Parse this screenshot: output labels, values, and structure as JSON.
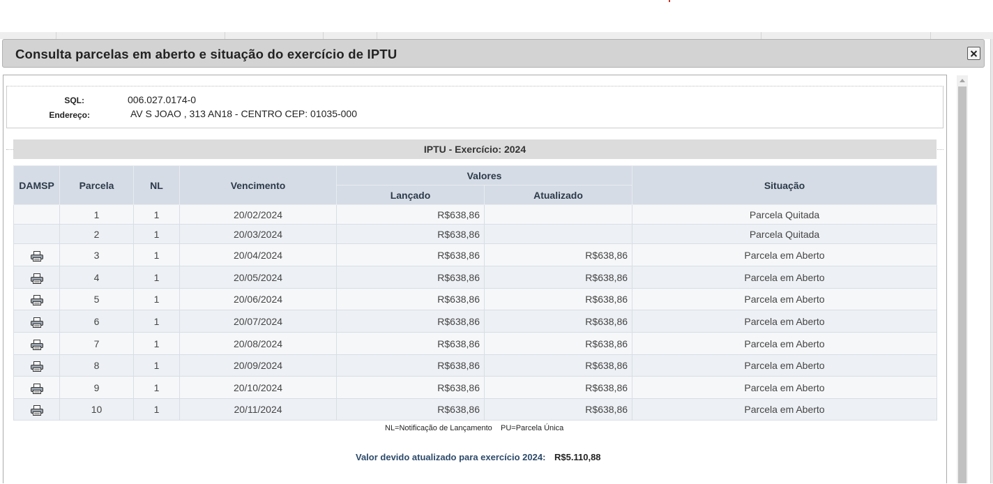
{
  "dialog": {
    "title": "Consulta parcelas em aberto e situação do exercício de IPTU"
  },
  "property": {
    "sql_label": "SQL:",
    "sql_value": "006.027.0174-0",
    "address_label": "Endereço:",
    "address_value": "AV S JOAO , 313 AN18 - CENTRO CEP: 01035-000"
  },
  "exercise": {
    "header": "IPTU - Exercício: 2024"
  },
  "table": {
    "headers": {
      "damsp": "DAMSP",
      "parcela": "Parcela",
      "nl": "NL",
      "vencimento": "Vencimento",
      "valores": "Valores",
      "lancado": "Lançado",
      "atualizado": "Atualizado",
      "situacao": "Situação"
    },
    "rows": [
      {
        "print": false,
        "parcela": "1",
        "nl": "1",
        "vencimento": "20/02/2024",
        "lancado": "R$638,86",
        "atualizado": "",
        "situacao": "Parcela Quitada"
      },
      {
        "print": false,
        "parcela": "2",
        "nl": "1",
        "vencimento": "20/03/2024",
        "lancado": "R$638,86",
        "atualizado": "",
        "situacao": "Parcela Quitada"
      },
      {
        "print": true,
        "parcela": "3",
        "nl": "1",
        "vencimento": "20/04/2024",
        "lancado": "R$638,86",
        "atualizado": "R$638,86",
        "situacao": "Parcela em Aberto"
      },
      {
        "print": true,
        "parcela": "4",
        "nl": "1",
        "vencimento": "20/05/2024",
        "lancado": "R$638,86",
        "atualizado": "R$638,86",
        "situacao": "Parcela em Aberto"
      },
      {
        "print": true,
        "parcela": "5",
        "nl": "1",
        "vencimento": "20/06/2024",
        "lancado": "R$638,86",
        "atualizado": "R$638,86",
        "situacao": "Parcela em Aberto"
      },
      {
        "print": true,
        "parcela": "6",
        "nl": "1",
        "vencimento": "20/07/2024",
        "lancado": "R$638,86",
        "atualizado": "R$638,86",
        "situacao": "Parcela em Aberto"
      },
      {
        "print": true,
        "parcela": "7",
        "nl": "1",
        "vencimento": "20/08/2024",
        "lancado": "R$638,86",
        "atualizado": "R$638,86",
        "situacao": "Parcela em Aberto"
      },
      {
        "print": true,
        "parcela": "8",
        "nl": "1",
        "vencimento": "20/09/2024",
        "lancado": "R$638,86",
        "atualizado": "R$638,86",
        "situacao": "Parcela em Aberto"
      },
      {
        "print": true,
        "parcela": "9",
        "nl": "1",
        "vencimento": "20/10/2024",
        "lancado": "R$638,86",
        "atualizado": "R$638,86",
        "situacao": "Parcela em Aberto"
      },
      {
        "print": true,
        "parcela": "10",
        "nl": "1",
        "vencimento": "20/11/2024",
        "lancado": "R$638,86",
        "atualizado": "R$638,86",
        "situacao": "Parcela em Aberto"
      }
    ]
  },
  "legend": "NL=Notificação de Lançamento    PU=Parcela Única",
  "total": {
    "label": "Valor devido atualizado para exercício 2024:",
    "value": "R$5.110,88"
  },
  "colors": {
    "header_bg": "#d6dce5",
    "title_bar": "#d3d3d3",
    "total_label": "#2d4a6a"
  },
  "icons": {
    "print": "printer-icon",
    "close": "close-icon"
  }
}
